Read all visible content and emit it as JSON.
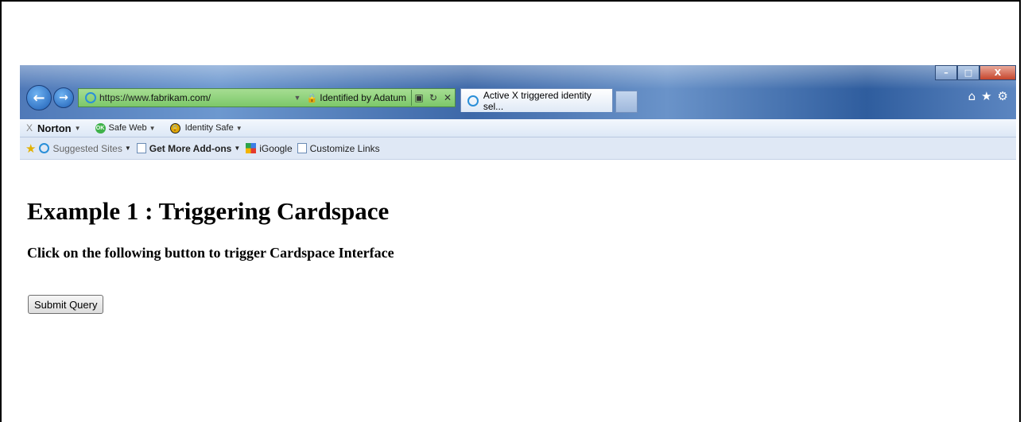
{
  "browser": {
    "address_url_prefix": "https://www.",
    "address_url_domain": "fabrikam.com/",
    "identity_label": "Identified by Adatum",
    "tab_title": "Active X triggered identity sel...",
    "window_minimize": "–",
    "window_maximize": "□",
    "window_close": "X"
  },
  "norton_bar": {
    "close_label": "X",
    "brand": "Norton",
    "safe_web": "Safe Web",
    "identity_safe": "Identity Safe"
  },
  "favorites_bar": {
    "suggested_sites": "Suggested Sites",
    "get_more_addons": "Get More Add-ons",
    "igoogle": "iGoogle",
    "customize_links": "Customize Links"
  },
  "page": {
    "heading": "Example 1 : Triggering Cardspace",
    "subheading": "Click on the following button to trigger Cardspace Interface",
    "submit_label": "Submit Query"
  },
  "icons": [
    "back-icon",
    "forward-icon",
    "ie-icon",
    "lock-icon",
    "compat-icon",
    "refresh-icon",
    "stop-icon",
    "home-icon",
    "favorites-star-icon",
    "gear-icon"
  ]
}
